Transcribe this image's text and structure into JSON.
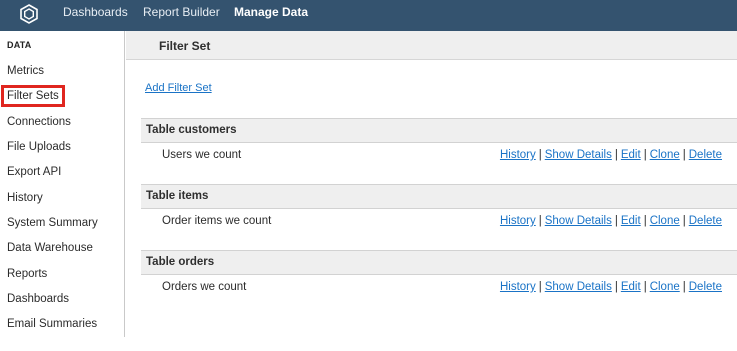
{
  "topnav": {
    "logo_icon": "hexagon-logo-icon",
    "items": [
      "Dashboards",
      "Report Builder",
      "Manage Data"
    ],
    "active_item": "Manage Data"
  },
  "sidebar": {
    "heading": "DATA",
    "items": [
      {
        "label": "Metrics"
      },
      {
        "label": "Filter Sets",
        "selected": true
      },
      {
        "label": "Connections"
      },
      {
        "label": "File Uploads"
      },
      {
        "label": "Export API"
      },
      {
        "label": "History"
      },
      {
        "label": "System Summary"
      },
      {
        "label": "Data Warehouse"
      },
      {
        "label": "Reports"
      },
      {
        "label": "Dashboards"
      },
      {
        "label": "Email Summaries"
      }
    ]
  },
  "main": {
    "title": "Filter Set",
    "add_link": "Add Filter Set",
    "action_labels": {
      "history": "History",
      "show_details": "Show Details",
      "edit": "Edit",
      "clone": "Clone",
      "delete": "Delete",
      "separator": "|"
    },
    "sections": [
      {
        "title": "Table customers",
        "rows": [
          {
            "name": "Users we count"
          }
        ]
      },
      {
        "title": "Table items",
        "rows": [
          {
            "name": "Order items we count"
          }
        ]
      },
      {
        "title": "Table orders",
        "rows": [
          {
            "name": "Orders we count"
          }
        ]
      }
    ]
  },
  "colors": {
    "topbar": "#34536f",
    "link": "#1a73c6",
    "selection_outline": "#e0261f",
    "header_bg": "#efefef"
  }
}
